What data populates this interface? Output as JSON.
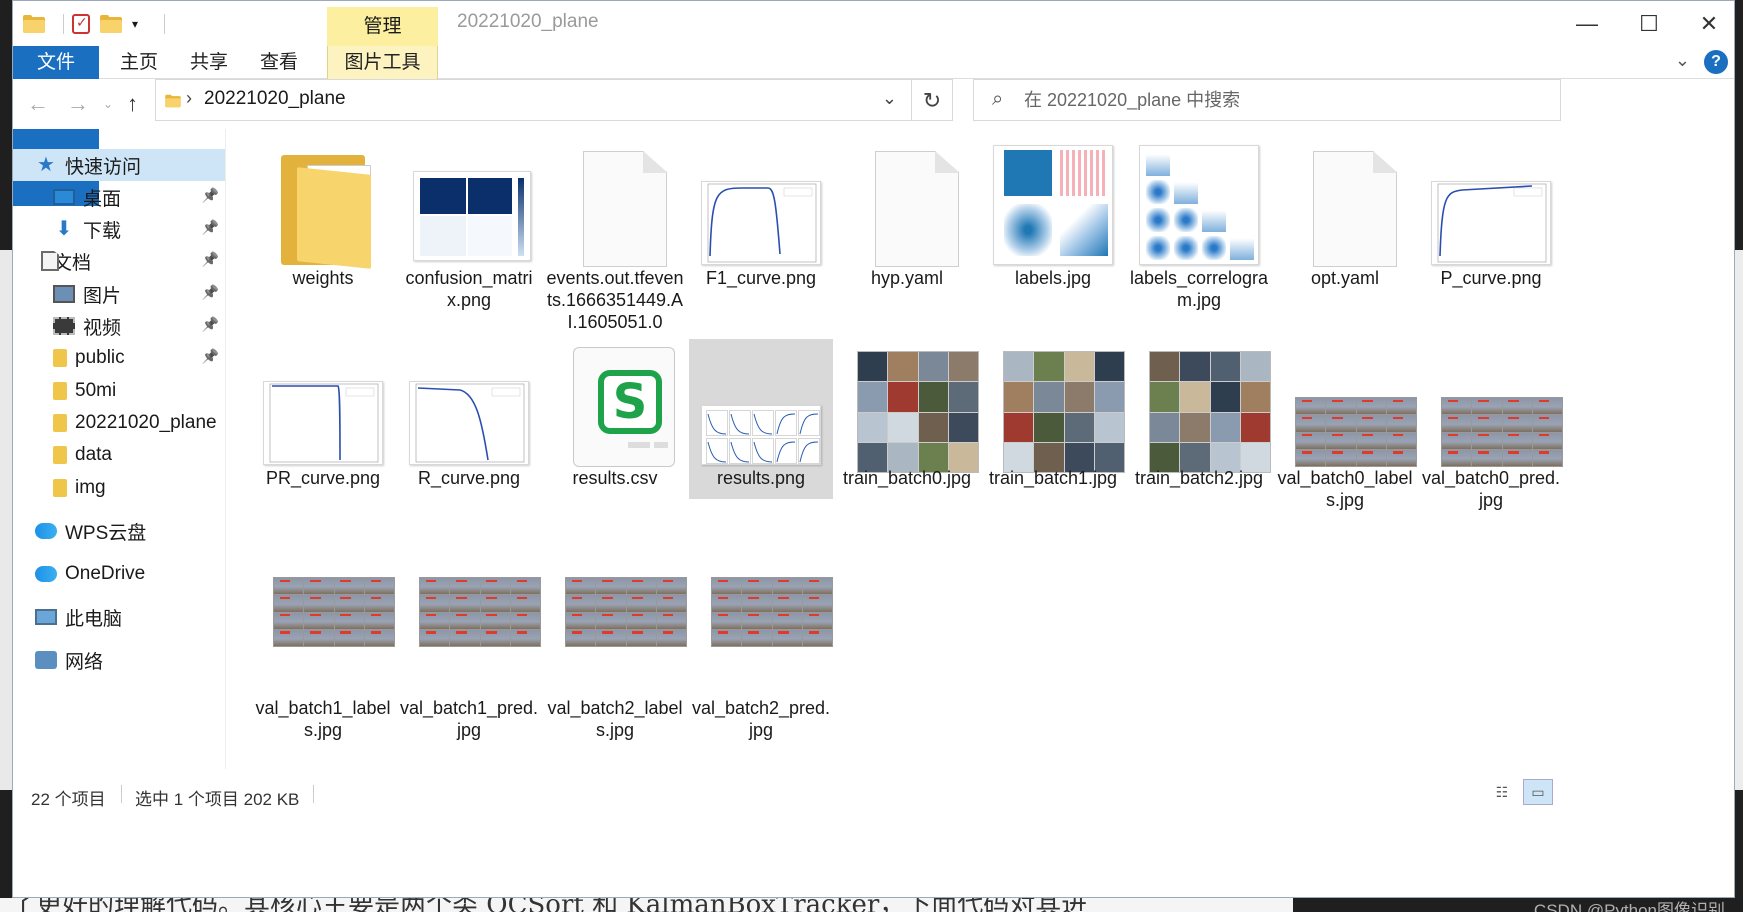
{
  "window": {
    "title": "20221020_plane",
    "ribbon_context_tab": "管理",
    "minimize": "—",
    "maximize": "☐",
    "close": "✕"
  },
  "ribbon": {
    "tabs": [
      "文件",
      "主页",
      "共享",
      "查看",
      "图片工具"
    ],
    "collapse_icon": "chevron-down-icon",
    "help": "?"
  },
  "address": {
    "path": "20221020_plane",
    "separator": "›",
    "search_placeholder": "在 20221020_plane 中搜索"
  },
  "sidebar": {
    "items": [
      {
        "label": "快速访问",
        "icon": "star-icon",
        "pinned": false,
        "selected": true
      },
      {
        "label": "桌面",
        "icon": "desktop-icon",
        "pinned": true
      },
      {
        "label": "下载",
        "icon": "download-icon",
        "pinned": true
      },
      {
        "label": "文档",
        "icon": "document-icon",
        "pinned": true
      },
      {
        "label": "图片",
        "icon": "picture-icon",
        "pinned": true
      },
      {
        "label": "视频",
        "icon": "video-icon",
        "pinned": true
      },
      {
        "label": "public",
        "icon": "folder-icon",
        "pinned": true
      },
      {
        "label": "50mi",
        "icon": "folder-icon",
        "pinned": false
      },
      {
        "label": "20221020_plane",
        "icon": "folder-icon",
        "pinned": false
      },
      {
        "label": "data",
        "icon": "folder-icon",
        "pinned": false
      },
      {
        "label": "img",
        "icon": "folder-icon",
        "pinned": false
      },
      {
        "label": "WPS云盘",
        "icon": "cloud-icon",
        "pinned": false
      },
      {
        "label": "OneDrive",
        "icon": "cloud-icon",
        "pinned": false
      },
      {
        "label": "此电脑",
        "icon": "computer-icon",
        "pinned": false
      },
      {
        "label": "网络",
        "icon": "network-icon",
        "pinned": false
      }
    ]
  },
  "files": [
    {
      "name": "weights",
      "kind": "folder"
    },
    {
      "name": "confusion_matrix.png",
      "kind": "confusion"
    },
    {
      "name": "events.out.tfevents.1666351449.AI.1605051.0",
      "kind": "blank"
    },
    {
      "name": "F1_curve.png",
      "kind": "curve"
    },
    {
      "name": "hyp.yaml",
      "kind": "blank"
    },
    {
      "name": "labels.jpg",
      "kind": "labels"
    },
    {
      "name": "labels_correlogram.jpg",
      "kind": "correlogram"
    },
    {
      "name": "opt.yaml",
      "kind": "blank"
    },
    {
      "name": "P_curve.png",
      "kind": "curve"
    },
    {
      "name": "PR_curve.png",
      "kind": "curve"
    },
    {
      "name": "R_curve.png",
      "kind": "curve"
    },
    {
      "name": "results.csv",
      "kind": "csv"
    },
    {
      "name": "results.png",
      "kind": "results",
      "selected": true
    },
    {
      "name": "train_batch0.jpg",
      "kind": "train"
    },
    {
      "name": "train_batch1.jpg",
      "kind": "train"
    },
    {
      "name": "train_batch2.jpg",
      "kind": "train"
    },
    {
      "name": "val_batch0_labels.jpg",
      "kind": "val"
    },
    {
      "name": "val_batch0_pred.jpg",
      "kind": "val"
    },
    {
      "name": "val_batch1_labels.jpg",
      "kind": "valtall"
    },
    {
      "name": "val_batch1_pred.jpg",
      "kind": "valtall"
    },
    {
      "name": "val_batch2_labels.jpg",
      "kind": "valtall"
    },
    {
      "name": "val_batch2_pred.jpg",
      "kind": "valtall"
    }
  ],
  "status": {
    "count": "22 个项目",
    "selection": "选中 1 个项目  202 KB"
  },
  "background": {
    "bottom_text": "了更好的理解代码。其核心主要是两个类 OCSort 和 KalmanBoxTracker，下面代码对其进",
    "watermark": "CSDN @Python图像识别"
  }
}
